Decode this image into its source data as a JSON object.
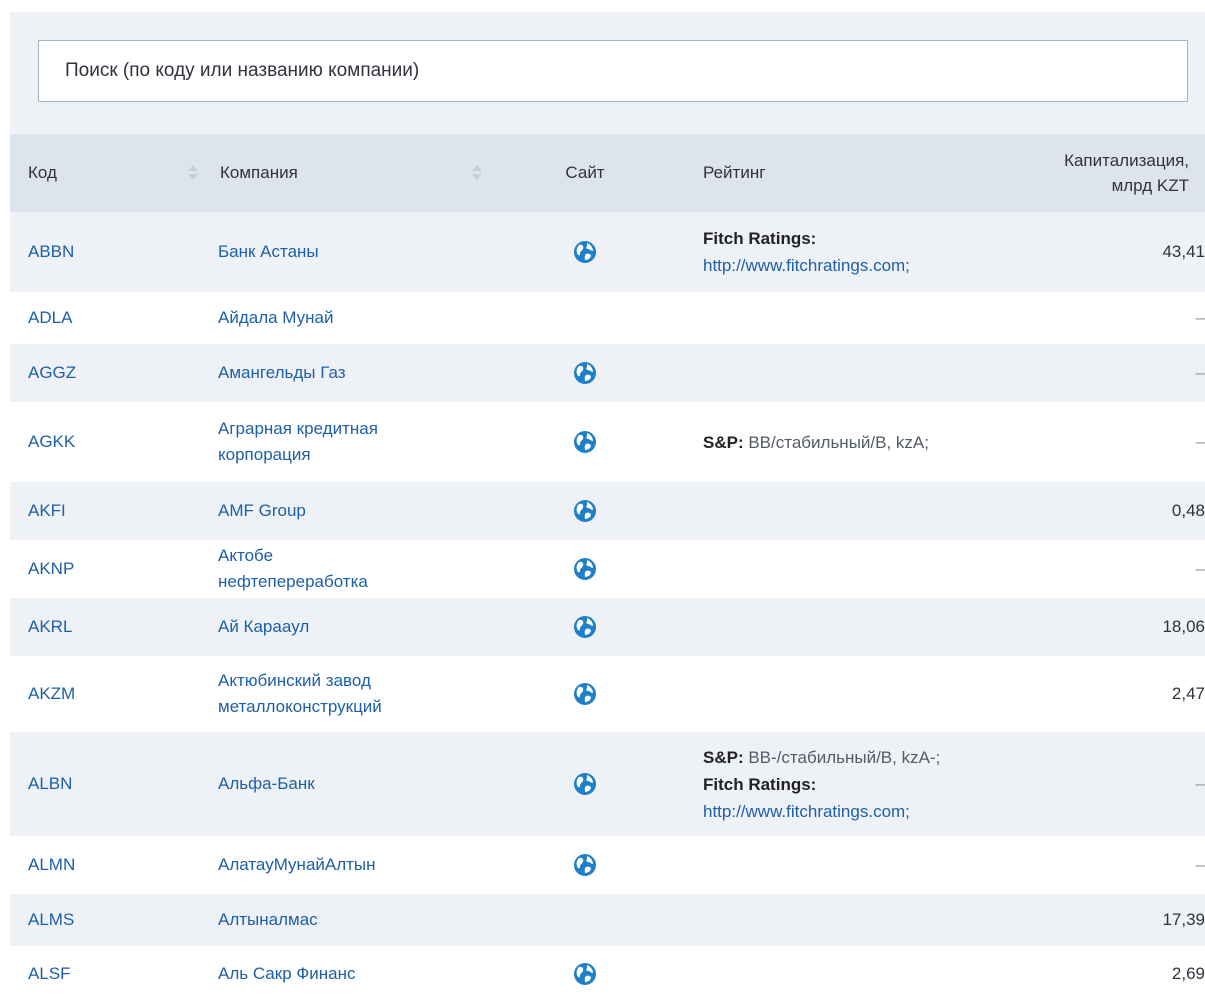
{
  "search": {
    "placeholder": "Поиск (по коду или названию компании)"
  },
  "table": {
    "headers": {
      "code": "Код",
      "company": "Компания",
      "site": "Сайт",
      "rating": "Рейтинг",
      "cap_line1": "Капитализация,",
      "cap_line2": "млрд KZT"
    },
    "rows": [
      {
        "code": "ABBN",
        "company": "Банк Астаны",
        "has_site": true,
        "rating": [
          {
            "agency": "Fitch Ratings:",
            "text": "",
            "link": "http://www.fitchratings.com;"
          }
        ],
        "cap": "43,41"
      },
      {
        "code": "ADLA",
        "company": "Айдала Мунай",
        "has_site": false,
        "rating": [],
        "cap": "–"
      },
      {
        "code": "AGGZ",
        "company": "Амангельды Газ",
        "has_site": true,
        "rating": [],
        "cap": "–"
      },
      {
        "code": "AGKK",
        "company": "Аграрная кредитная корпорация",
        "has_site": true,
        "rating": [
          {
            "agency": "S&P:",
            "text": " BB/стабильный/B, kzA;",
            "link": ""
          }
        ],
        "cap": "–"
      },
      {
        "code": "AKFI",
        "company": "AMF Group",
        "has_site": true,
        "rating": [],
        "cap": "0,48"
      },
      {
        "code": "AKNP",
        "company": "Актобе нефтепереработка",
        "has_site": true,
        "rating": [],
        "cap": "–"
      },
      {
        "code": "AKRL",
        "company": "Ай Караaул",
        "has_site": true,
        "rating": [],
        "cap": "18,06"
      },
      {
        "code": "AKZM",
        "company": "Актюбинский завод металлоконструкций",
        "has_site": true,
        "rating": [],
        "cap": "2,47"
      },
      {
        "code": "ALBN",
        "company": "Альфа-Банк",
        "has_site": true,
        "rating": [
          {
            "agency": "S&P:",
            "text": " BB-/стабильный/B, kzA-;",
            "link": ""
          },
          {
            "agency": "Fitch Ratings:",
            "text": "",
            "link": "http://www.fitchratings.com;"
          }
        ],
        "cap": "–"
      },
      {
        "code": "ALMN",
        "company": "АлатауМунайАлтын",
        "has_site": true,
        "rating": [],
        "cap": "–"
      },
      {
        "code": "ALMS",
        "company": "Алтыналмас",
        "has_site": false,
        "rating": [],
        "cap": "17,39"
      },
      {
        "code": "ALSF",
        "company": "Аль Сакр Финанс",
        "has_site": true,
        "rating": [],
        "cap": "2,69"
      }
    ]
  },
  "colors": {
    "link": "#1d5fa8",
    "globe": "#1f7fc8",
    "header_bg": "#dde4ed",
    "stripe_bg": "#eef2f6"
  }
}
